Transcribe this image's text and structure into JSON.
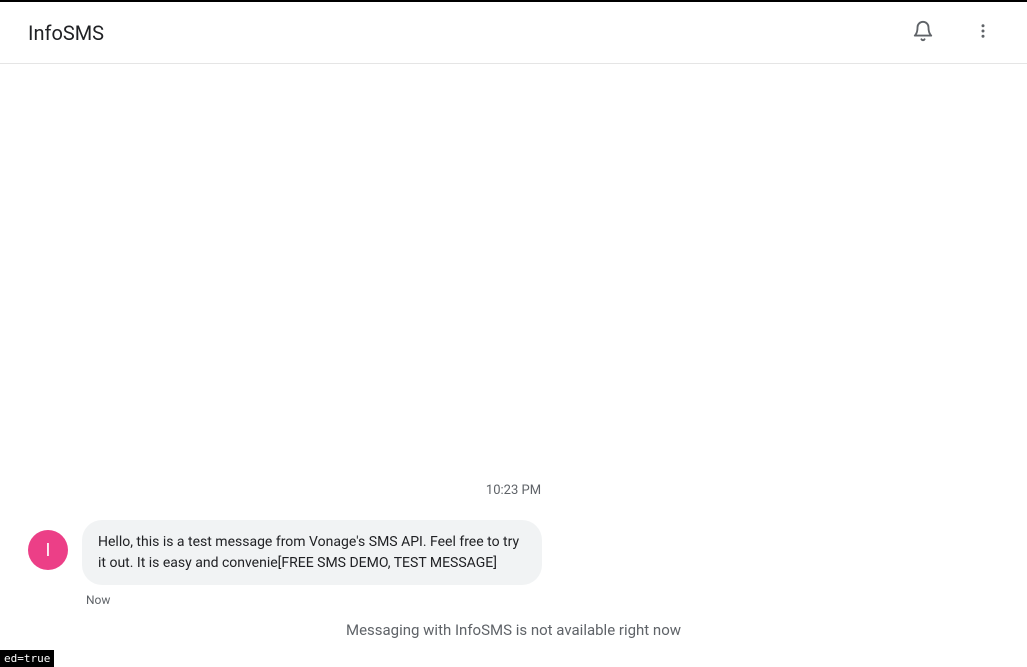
{
  "header": {
    "title": "InfoSMS"
  },
  "conversation": {
    "timestamp": "10:23 PM",
    "avatar_initial": "I",
    "message_text": "Hello, this is a test message from Vonage's SMS API. Feel free to try it out. It is easy and convenie[FREE SMS DEMO, TEST MESSAGE]",
    "message_meta": "Now"
  },
  "footer": {
    "availability_notice": "Messaging with InfoSMS is not available right now"
  },
  "debug": {
    "badge": "ed=true"
  }
}
